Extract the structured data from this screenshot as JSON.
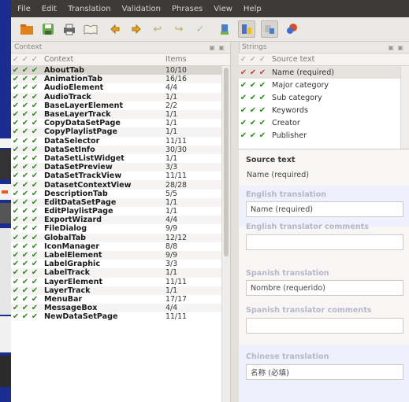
{
  "menubar": {
    "items": [
      "File",
      "Edit",
      "Translation",
      "Validation",
      "Phrases",
      "View",
      "Help"
    ]
  },
  "toolbar": {
    "icons": [
      "open-icon",
      "save-icon",
      "print-icon",
      "phrasebook-icon",
      "prev-icon",
      "next-icon",
      "prev-unfinished-icon",
      "next-unfinished-icon",
      "done-next-icon",
      "accelerator-icon",
      "punctuation-icon",
      "phrase-match-icon",
      "place-marker-icon"
    ]
  },
  "context_pane": {
    "title": "Context",
    "controls": "▣ ▣",
    "columns": {
      "context": "Context",
      "items": "Items"
    },
    "rows": [
      {
        "name": "AboutTab",
        "items": "10/10"
      },
      {
        "name": "AnimationTab",
        "items": "16/16"
      },
      {
        "name": "AudioElement",
        "items": "4/4"
      },
      {
        "name": "AudioTrack",
        "items": "1/1"
      },
      {
        "name": "BaseLayerElement",
        "items": "2/2"
      },
      {
        "name": "BaseLayerTrack",
        "items": "1/1"
      },
      {
        "name": "CopyDataSetPage",
        "items": "1/1"
      },
      {
        "name": "CopyPlaylistPage",
        "items": "1/1"
      },
      {
        "name": "DataSelector",
        "items": "11/11"
      },
      {
        "name": "DataSetInfo",
        "items": "30/30"
      },
      {
        "name": "DataSetListWidget",
        "items": "1/1"
      },
      {
        "name": "DataSetPreview",
        "items": "3/3"
      },
      {
        "name": "DataSetTrackView",
        "items": "11/11"
      },
      {
        "name": "DatasetContextView",
        "items": "28/28"
      },
      {
        "name": "DescriptionTab",
        "items": "5/5"
      },
      {
        "name": "EditDataSetPage",
        "items": "1/1"
      },
      {
        "name": "EditPlaylistPage",
        "items": "1/1"
      },
      {
        "name": "ExportWizard",
        "items": "4/4"
      },
      {
        "name": "FileDialog",
        "items": "9/9"
      },
      {
        "name": "GlobalTab",
        "items": "12/12"
      },
      {
        "name": "IconManager",
        "items": "8/8"
      },
      {
        "name": "LabelElement",
        "items": "9/9"
      },
      {
        "name": "LabelGraphic",
        "items": "3/3"
      },
      {
        "name": "LabelTrack",
        "items": "1/1"
      },
      {
        "name": "LayerElement",
        "items": "11/11"
      },
      {
        "name": "LayerTrack",
        "items": "1/1"
      },
      {
        "name": "MenuBar",
        "items": "17/17"
      },
      {
        "name": "MessageBox",
        "items": "4/4"
      },
      {
        "name": "NewDataSetPage",
        "items": "11/11"
      }
    ]
  },
  "strings_pane": {
    "title": "Strings",
    "controls": "▣ ▣",
    "columns": {
      "source": "Source text"
    },
    "rows": [
      {
        "text": "Name (required)"
      },
      {
        "text": "Major category"
      },
      {
        "text": "Sub category"
      },
      {
        "text": "Keywords"
      },
      {
        "text": "Creator"
      },
      {
        "text": "Publisher"
      }
    ]
  },
  "editor": {
    "source_label": "Source text",
    "source_value": "Name (required)",
    "english_label": "English translation",
    "english_value": "Name (required)",
    "english_comments_label": "English translator comments",
    "english_comments_value": "",
    "spanish_label": "Spanish translation",
    "spanish_value": "Nombre (requerido)",
    "spanish_comments_label": "Spanish translator comments",
    "spanish_comments_value": "",
    "chinese_label": "Chinese translation",
    "chinese_value": "名称 (必填)"
  },
  "colors": {
    "check_green": "#2e8b1e",
    "menubar_bg": "#3c3b37",
    "desktop_blue": "#1b2c8f"
  }
}
